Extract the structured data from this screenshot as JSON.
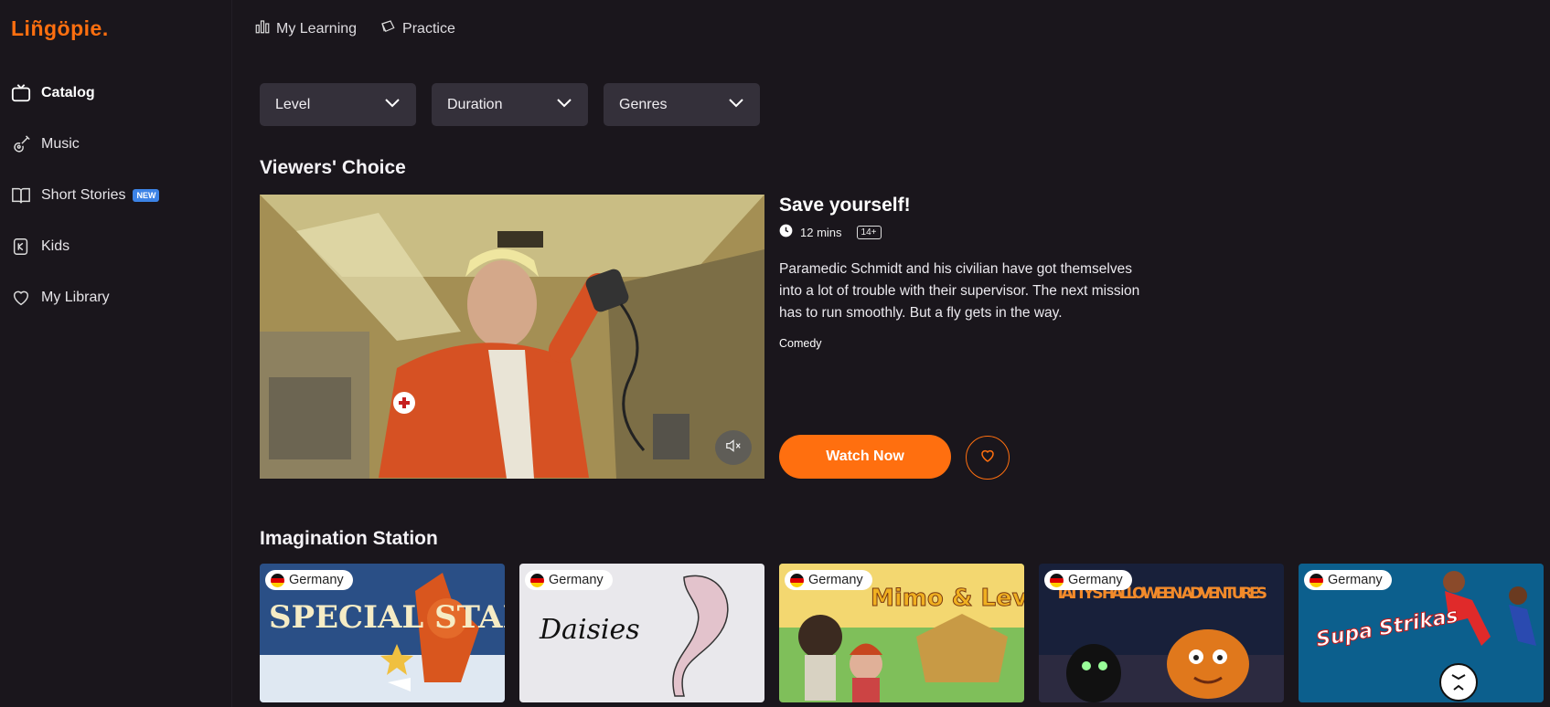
{
  "brand": {
    "logo": "Liñgöpie."
  },
  "sidebar": {
    "items": [
      {
        "label": "Catalog",
        "icon": "tv-icon",
        "active": true
      },
      {
        "label": "Music",
        "icon": "guitar-icon"
      },
      {
        "label": "Short Stories",
        "icon": "book-icon",
        "badge": "NEW"
      },
      {
        "label": "Kids",
        "icon": "kids-icon"
      },
      {
        "label": "My Library",
        "icon": "heart-icon"
      }
    ]
  },
  "topnav": {
    "my_learning": "My Learning",
    "practice": "Practice"
  },
  "filters": {
    "level": "Level",
    "duration": "Duration",
    "genres": "Genres"
  },
  "viewers_choice": {
    "section_title": "Viewers' Choice",
    "title": "Save yourself!",
    "duration": "12 mins",
    "age_rating": "14+",
    "description": "Paramedic Schmidt and his civilian have got themselves into a lot of trouble with their supervisor. The next mission has to run smoothly. But a fly gets in the way.",
    "genre": "Comedy",
    "watch_label": "Watch Now"
  },
  "imagination_station": {
    "section_title": "Imagination Station",
    "cards": [
      {
        "country": "Germany",
        "title_art": "SPECIAL STAR"
      },
      {
        "country": "Germany",
        "title_art": "Daisies"
      },
      {
        "country": "Germany",
        "title_art": "Mimo & Leva"
      },
      {
        "country": "Germany",
        "title_art": "TATTY'S HALLOWEEN ADVENTURES"
      },
      {
        "country": "Germany",
        "title_art": "Supa Strikas"
      }
    ]
  },
  "colors": {
    "accent": "#ff6f0f",
    "background": "#1a161c",
    "filter_bg": "#34303a",
    "badge": "#3c83e6"
  }
}
